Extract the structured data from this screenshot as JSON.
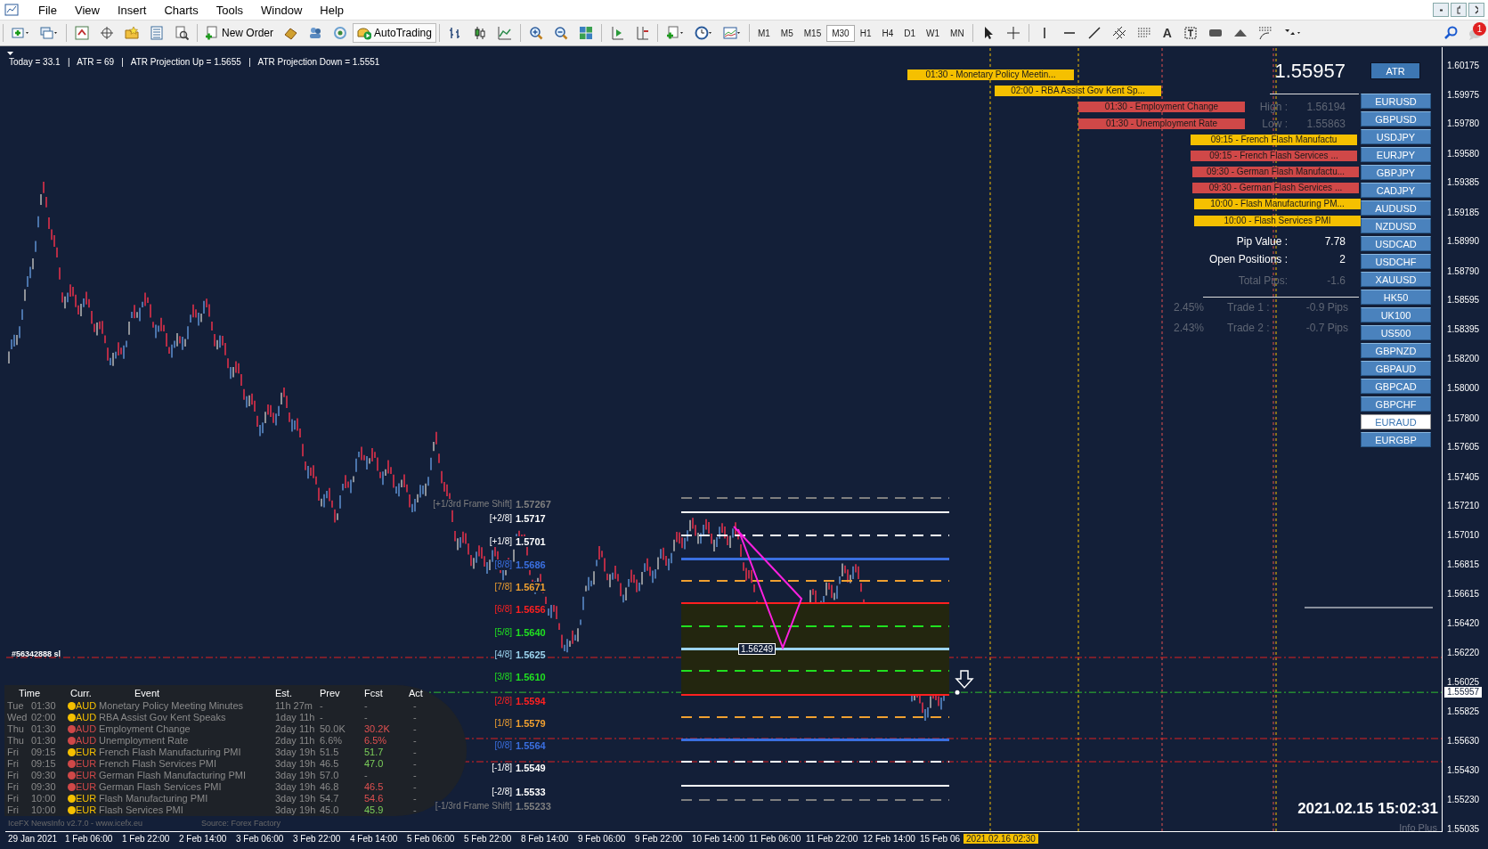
{
  "menu": {
    "items": [
      "File",
      "View",
      "Insert",
      "Charts",
      "Tools",
      "Window",
      "Help"
    ]
  },
  "toolbar": {
    "new_order": "New Order",
    "autotrading": {
      "label": "AutoTrading",
      "on": true
    },
    "text_tool": "A",
    "notifications": "1",
    "timeframes": [
      {
        "label": "M1",
        "selected": false
      },
      {
        "label": "M5",
        "selected": false
      },
      {
        "label": "M15",
        "selected": false
      },
      {
        "label": "M30",
        "selected": true
      },
      {
        "label": "H1",
        "selected": false
      },
      {
        "label": "H4",
        "selected": false
      },
      {
        "label": "D1",
        "selected": false
      },
      {
        "label": "W1",
        "selected": false
      },
      {
        "label": "MN",
        "selected": false
      }
    ]
  },
  "chart": {
    "indicator_line": "Today = 33.1   |   ATR = 69   |   ATR Projection Up = 1.5655   |   ATR Projection Down = 1.5551",
    "order_label": "#56342888 sl",
    "pivot_label": "1.56249",
    "murrey_levels": [
      {
        "label": "[+1/3rd Frame Shift]",
        "value": "1.57267",
        "color": "#7f7f7f"
      },
      {
        "label": "[+2/8]",
        "value": "1.5717",
        "color": "#ffffff"
      },
      {
        "label": "[+1/8]",
        "value": "1.5701",
        "color": "#ffffff"
      },
      {
        "label": "[8/8]",
        "value": "1.5686",
        "color": "#3a6fe0"
      },
      {
        "label": "[7/8]",
        "value": "1.5671",
        "color": "#f0a030"
      },
      {
        "label": "[6/8]",
        "value": "1.5656",
        "color": "#ff2020"
      },
      {
        "label": "[5/8]",
        "value": "1.5640",
        "color": "#20e020"
      },
      {
        "label": "[4/8]",
        "value": "1.5625",
        "color": "#9cd4ef"
      },
      {
        "label": "[3/8]",
        "value": "1.5610",
        "color": "#20e020"
      },
      {
        "label": "[2/8]",
        "value": "1.5594",
        "color": "#ff2020"
      },
      {
        "label": "[1/8]",
        "value": "1.5579",
        "color": "#f0a030"
      },
      {
        "label": "[0/8]",
        "value": "1.5564",
        "color": "#3a6fe0"
      },
      {
        "label": "[-1/8]",
        "value": "1.5549",
        "color": "#ffffff"
      },
      {
        "label": "[-2/8]",
        "value": "1.5533",
        "color": "#ffffff"
      },
      {
        "label": "[-1/3rd Frame Shift]",
        "value": "1.55233",
        "color": "#7f7f7f"
      }
    ],
    "news_bars": [
      {
        "text": "01:30 - Monetary Policy Meetin...",
        "color": "#f5c000"
      },
      {
        "text": "02:00 - RBA Assist Gov Kent Sp...",
        "color": "#f5c000"
      },
      {
        "text": "01:30 - Employment Change",
        "color": "#d04848"
      },
      {
        "text": "01:30 - Unemployment Rate",
        "color": "#d04848"
      },
      {
        "text": "09:15 - French Flash Manufactu",
        "color": "#f5c000"
      },
      {
        "text": "09:15 - French Flash Services ...",
        "color": "#d04848"
      },
      {
        "text": "09:30 - German Flash Manufactu...",
        "color": "#d04848"
      },
      {
        "text": "09:30 - German Flash Services ...",
        "color": "#d04848"
      },
      {
        "text": "10:00 - Flash Manufacturing PM...",
        "color": "#f5c000"
      },
      {
        "text": "10:00 - Flash Services PMI",
        "color": "#f5c000"
      }
    ],
    "info_panel": {
      "price": "1.55957",
      "rows": [
        {
          "label": "High :",
          "value": "1.56194",
          "dim": true
        },
        {
          "label": "Low :",
          "value": "1.55863",
          "dim": true
        },
        {
          "label": "Pip Value :",
          "value": "7.78",
          "dim": false
        },
        {
          "label": "Open Positions :",
          "value": "2",
          "dim": false
        },
        {
          "label": "Total Pips:",
          "value": "-1.6",
          "dim": true
        }
      ],
      "trades": [
        {
          "percent": "2.45%",
          "name": "Trade 1 :",
          "pips": "-0.9 Pips"
        },
        {
          "percent": "2.43%",
          "name": "Trade 2 :",
          "pips": "-0.7 Pips"
        }
      ]
    },
    "atr_button": "ATR",
    "symbols": [
      {
        "label": "EURUSD",
        "selected": false
      },
      {
        "label": "GBPUSD",
        "selected": false
      },
      {
        "label": "USDJPY",
        "selected": false
      },
      {
        "label": "EURJPY",
        "selected": false
      },
      {
        "label": "GBPJPY",
        "selected": false
      },
      {
        "label": "CADJPY",
        "selected": false
      },
      {
        "label": "AUDUSD",
        "selected": false
      },
      {
        "label": "NZDUSD",
        "selected": false
      },
      {
        "label": "USDCAD",
        "selected": false
      },
      {
        "label": "USDCHF",
        "selected": false
      },
      {
        "label": "XAUUSD",
        "selected": false
      },
      {
        "label": "HK50",
        "selected": false
      },
      {
        "label": "UK100",
        "selected": false
      },
      {
        "label": "US500",
        "selected": false
      },
      {
        "label": "GBPNZD",
        "selected": false
      },
      {
        "label": "GBPAUD",
        "selected": false
      },
      {
        "label": "GBPCAD",
        "selected": false
      },
      {
        "label": "GBPCHF",
        "selected": false
      },
      {
        "label": "EURAUD",
        "selected": true
      },
      {
        "label": "EURGBP",
        "selected": false
      }
    ],
    "news_table": {
      "columns": [
        "Time",
        "Curr.",
        "Event",
        "Est.",
        "Prev",
        "Fcst",
        "Act"
      ],
      "rows": [
        {
          "day": "Tue",
          "time": "01:30",
          "color": "#f5c000",
          "currency": "AUD",
          "event": "Monetary Policy Meeting Minutes",
          "est": "11h 27m",
          "prev": "-",
          "fcst": {
            "text": "-"
          },
          "act": "-"
        },
        {
          "day": "Wed",
          "time": "02:00",
          "color": "#f5c000",
          "currency": "AUD",
          "event": "RBA Assist Gov Kent Speaks",
          "est": "1day 11h",
          "prev": "-",
          "fcst": {
            "text": "-"
          },
          "act": "-"
        },
        {
          "day": "Thu",
          "time": "01:30",
          "color": "#d04848",
          "currency": "AUD",
          "event": "Employment Change",
          "est": "2day 11h",
          "prev": "50.0K",
          "fcst": {
            "text": "30.2K",
            "color": "#e05050"
          },
          "act": "-"
        },
        {
          "day": "Thu",
          "time": "01:30",
          "color": "#d04848",
          "currency": "AUD",
          "event": "Unemployment Rate",
          "est": "2day 11h",
          "prev": "6.6%",
          "fcst": {
            "text": "6.5%",
            "color": "#e05050"
          },
          "act": "-"
        },
        {
          "day": "Fri",
          "time": "09:15",
          "color": "#f5c000",
          "currency": "EUR",
          "event": "French Flash Manufacturing PMI",
          "est": "3day 19h",
          "prev": "51.5",
          "fcst": {
            "text": "51.7",
            "color": "#7ccf5a"
          },
          "act": "-"
        },
        {
          "day": "Fri",
          "time": "09:15",
          "color": "#d04848",
          "currency": "EUR",
          "event": "French Flash Services PMI",
          "est": "3day 19h",
          "prev": "46.5",
          "fcst": {
            "text": "47.0",
            "color": "#7ccf5a"
          },
          "act": "-"
        },
        {
          "day": "Fri",
          "time": "09:30",
          "color": "#d04848",
          "currency": "EUR",
          "event": "German Flash Manufacturing PMI",
          "est": "3day 19h",
          "prev": "57.0",
          "fcst": {
            "text": "-"
          },
          "act": "-"
        },
        {
          "day": "Fri",
          "time": "09:30",
          "color": "#d04848",
          "currency": "EUR",
          "event": "German Flash Services PMI",
          "est": "3day 19h",
          "prev": "46.8",
          "fcst": {
            "text": "46.5",
            "color": "#e05050"
          },
          "act": "-"
        },
        {
          "day": "Fri",
          "time": "10:00",
          "color": "#f5c000",
          "currency": "EUR",
          "event": "Flash Manufacturing PMI",
          "est": "3day 19h",
          "prev": "54.7",
          "fcst": {
            "text": "54.6",
            "color": "#e05050"
          },
          "act": "-"
        },
        {
          "day": "Fri",
          "time": "10:00",
          "color": "#f5c000",
          "currency": "EUR",
          "event": "Flash Services PMI",
          "est": "3day 19h",
          "prev": "45.0",
          "fcst": {
            "text": "45.9",
            "color": "#7ccf5a"
          },
          "act": "-"
        }
      ],
      "footer": "IceFX NewsInfo v2.7.0 - www.icefx.eu",
      "source": "Source: Forex Factory"
    },
    "price_axis": {
      "ticks": [
        "1.60175",
        "1.59975",
        "1.59780",
        "1.59580",
        "1.59385",
        "1.59185",
        "1.58990",
        "1.58790",
        "1.58595",
        "1.58395",
        "1.58200",
        "1.58000",
        "1.57800",
        "1.57605",
        "1.57405",
        "1.57210",
        "1.57010",
        "1.56815",
        "1.56615",
        "1.56420",
        "1.56220",
        "1.56025",
        "1.55825",
        "1.55630",
        "1.55430",
        "1.55230",
        "1.55035"
      ],
      "current": "1.55957"
    },
    "time_axis": {
      "labels": [
        "29 Jan 2021",
        "1 Feb 06:00",
        "1 Feb 22:00",
        "2 Feb 14:00",
        "3 Feb 06:00",
        "3 Feb 22:00",
        "4 Feb 14:00",
        "5 Feb 06:00",
        "5 Feb 22:00",
        "8 Feb 14:00",
        "9 Feb 06:00",
        "9 Feb 22:00",
        "10 Feb 14:00",
        "11 Feb 06:00",
        "11 Feb 22:00",
        "12 Feb 14:00",
        "15 Feb 06"
      ],
      "cursor": "2021.02.16 02:30"
    },
    "server_time": "2021.02.15 15:02:31",
    "plugin_label": "Info Plus"
  }
}
